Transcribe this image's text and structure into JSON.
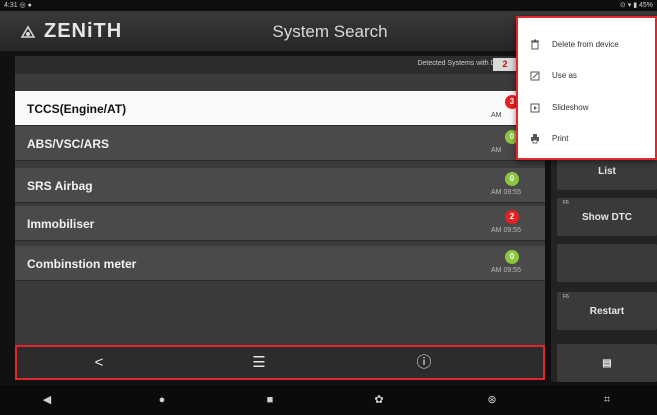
{
  "status_bar": {
    "left": "4:31 ◎ ●",
    "right": "⊙ ▾ ▮ 45%"
  },
  "header": {
    "brand": "ZENiTH",
    "title": "System Search"
  },
  "panel": {
    "detected_label": "Detected Systems with DTC",
    "detected_count": "2",
    "rows": [
      {
        "name": "TCCS(Engine/AT)",
        "badge": "3",
        "badge_color": "#e52222",
        "time": "AM",
        "selected": true
      },
      {
        "name": "ABS/VSC/ARS",
        "badge": "0",
        "badge_color": "#8cc63f",
        "time": "AM",
        "selected": false
      },
      {
        "name": "SRS Airbag",
        "badge": "0",
        "badge_color": "#8cc63f",
        "time": "AM 09:55",
        "selected": false
      },
      {
        "name": "Immobiliser",
        "badge": "2",
        "badge_color": "#e52222",
        "time": "AM 09:55",
        "selected": false
      },
      {
        "name": "Combinstion meter",
        "badge": "0",
        "badge_color": "#8cc63f",
        "time": "AM 09:55",
        "selected": false
      }
    ]
  },
  "action_bar": {
    "share_icon": "<",
    "adjust_icon": "☰",
    "info_icon": "ⓘ"
  },
  "side_buttons": [
    {
      "fn": "F6",
      "label": "List"
    },
    {
      "fn": "F6",
      "label": "Show DTC"
    },
    {
      "fn": "",
      "label": ""
    },
    {
      "fn": "F6",
      "label": "Restart"
    },
    {
      "fn": "",
      "label": "▤"
    }
  ],
  "menu": {
    "items": [
      {
        "label": "Delete from device",
        "icon": "trash-icon"
      },
      {
        "label": "Use as",
        "icon": "edit-icon"
      },
      {
        "label": "Slideshow",
        "icon": "slideshow-icon"
      },
      {
        "label": "Print",
        "icon": "print-icon"
      }
    ]
  },
  "navbar": {
    "back": "◀",
    "home": "●",
    "recents": "■",
    "settings": "✿",
    "camera": "⊛",
    "screenshot": "⌗"
  }
}
